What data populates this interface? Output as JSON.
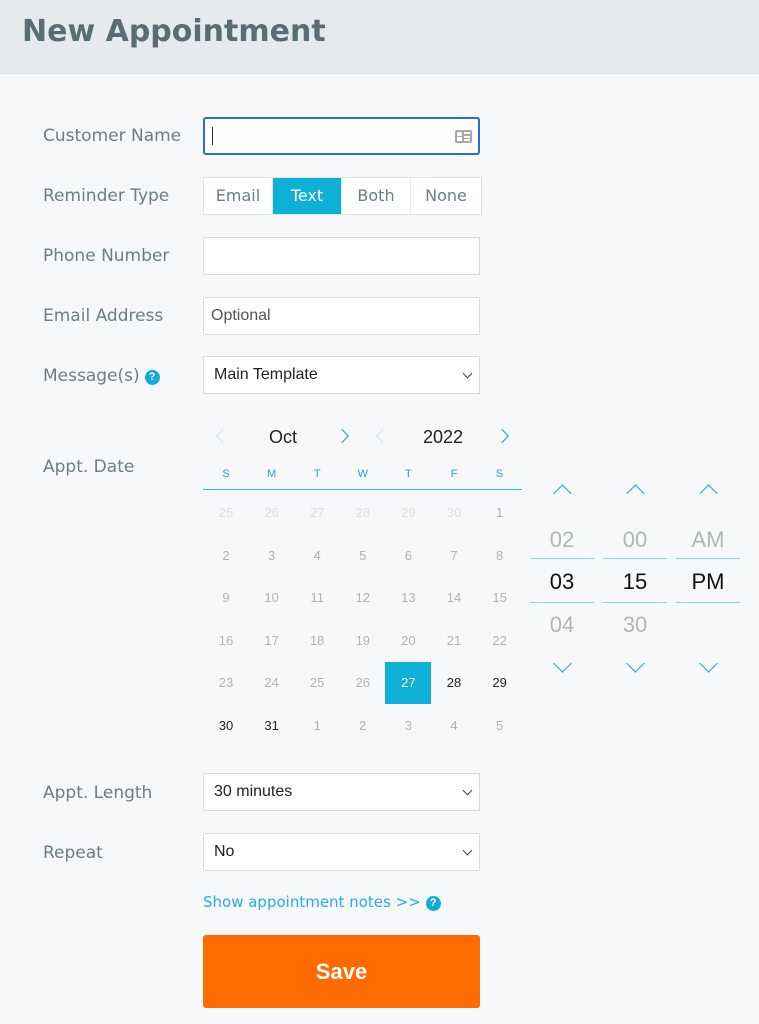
{
  "header": {
    "title": "New Appointment"
  },
  "colors": {
    "accent": "#0fb0d6",
    "save": "#ff6b00",
    "focus": "#2a6bd6",
    "label": "#6b7e83"
  },
  "form": {
    "customer_name": {
      "label": "Customer Name",
      "value": "",
      "icon": "contact-card-icon"
    },
    "reminder_type": {
      "label": "Reminder Type",
      "options": [
        "Email",
        "Text",
        "Both",
        "None"
      ],
      "selected": "Text"
    },
    "phone_number": {
      "label": "Phone Number",
      "value": ""
    },
    "email_address": {
      "label": "Email Address",
      "placeholder": "Optional"
    },
    "messages": {
      "label": "Message(s)",
      "help_icon": "?",
      "value": "Main Template"
    },
    "appt_date": {
      "label": "Appt. Date",
      "month": "Oct",
      "year": "2022",
      "weekdays": [
        "S",
        "M",
        "T",
        "W",
        "T",
        "F",
        "S"
      ],
      "weeks": [
        [
          {
            "d": "25",
            "t": "other"
          },
          {
            "d": "26",
            "t": "other"
          },
          {
            "d": "27",
            "t": "other"
          },
          {
            "d": "28",
            "t": "other"
          },
          {
            "d": "29",
            "t": "other"
          },
          {
            "d": "30",
            "t": "other"
          },
          {
            "d": "1",
            "t": "past"
          }
        ],
        [
          {
            "d": "2",
            "t": "past"
          },
          {
            "d": "3",
            "t": "past"
          },
          {
            "d": "4",
            "t": "past"
          },
          {
            "d": "5",
            "t": "past"
          },
          {
            "d": "6",
            "t": "past"
          },
          {
            "d": "7",
            "t": "past"
          },
          {
            "d": "8",
            "t": "past"
          }
        ],
        [
          {
            "d": "9",
            "t": "past"
          },
          {
            "d": "10",
            "t": "past"
          },
          {
            "d": "11",
            "t": "past"
          },
          {
            "d": "12",
            "t": "past"
          },
          {
            "d": "13",
            "t": "past"
          },
          {
            "d": "14",
            "t": "past"
          },
          {
            "d": "15",
            "t": "past"
          }
        ],
        [
          {
            "d": "16",
            "t": "past"
          },
          {
            "d": "17",
            "t": "past"
          },
          {
            "d": "18",
            "t": "past"
          },
          {
            "d": "19",
            "t": "past"
          },
          {
            "d": "20",
            "t": "past"
          },
          {
            "d": "21",
            "t": "past"
          },
          {
            "d": "22",
            "t": "past"
          }
        ],
        [
          {
            "d": "23",
            "t": "past"
          },
          {
            "d": "24",
            "t": "past"
          },
          {
            "d": "25",
            "t": "past"
          },
          {
            "d": "26",
            "t": "past"
          },
          {
            "d": "27",
            "t": "sel"
          },
          {
            "d": "28",
            "t": "cur"
          },
          {
            "d": "29",
            "t": "cur"
          }
        ],
        [
          {
            "d": "30",
            "t": "cur"
          },
          {
            "d": "31",
            "t": "cur"
          },
          {
            "d": "1",
            "t": "past"
          },
          {
            "d": "2",
            "t": "past"
          },
          {
            "d": "3",
            "t": "past"
          },
          {
            "d": "4",
            "t": "past"
          },
          {
            "d": "5",
            "t": "past"
          }
        ]
      ]
    },
    "appt_time": {
      "hour": {
        "prev": "02",
        "current": "03",
        "next": "04"
      },
      "minute": {
        "prev": "00",
        "current": "15",
        "next": "30"
      },
      "period": {
        "prev": "AM",
        "current": "PM",
        "next": ""
      }
    },
    "appt_length": {
      "label": "Appt. Length",
      "value": "30 minutes"
    },
    "repeat": {
      "label": "Repeat",
      "value": "No"
    },
    "notes_link": "Show appointment notes >>",
    "notes_help_icon": "?",
    "save_label": "Save"
  }
}
